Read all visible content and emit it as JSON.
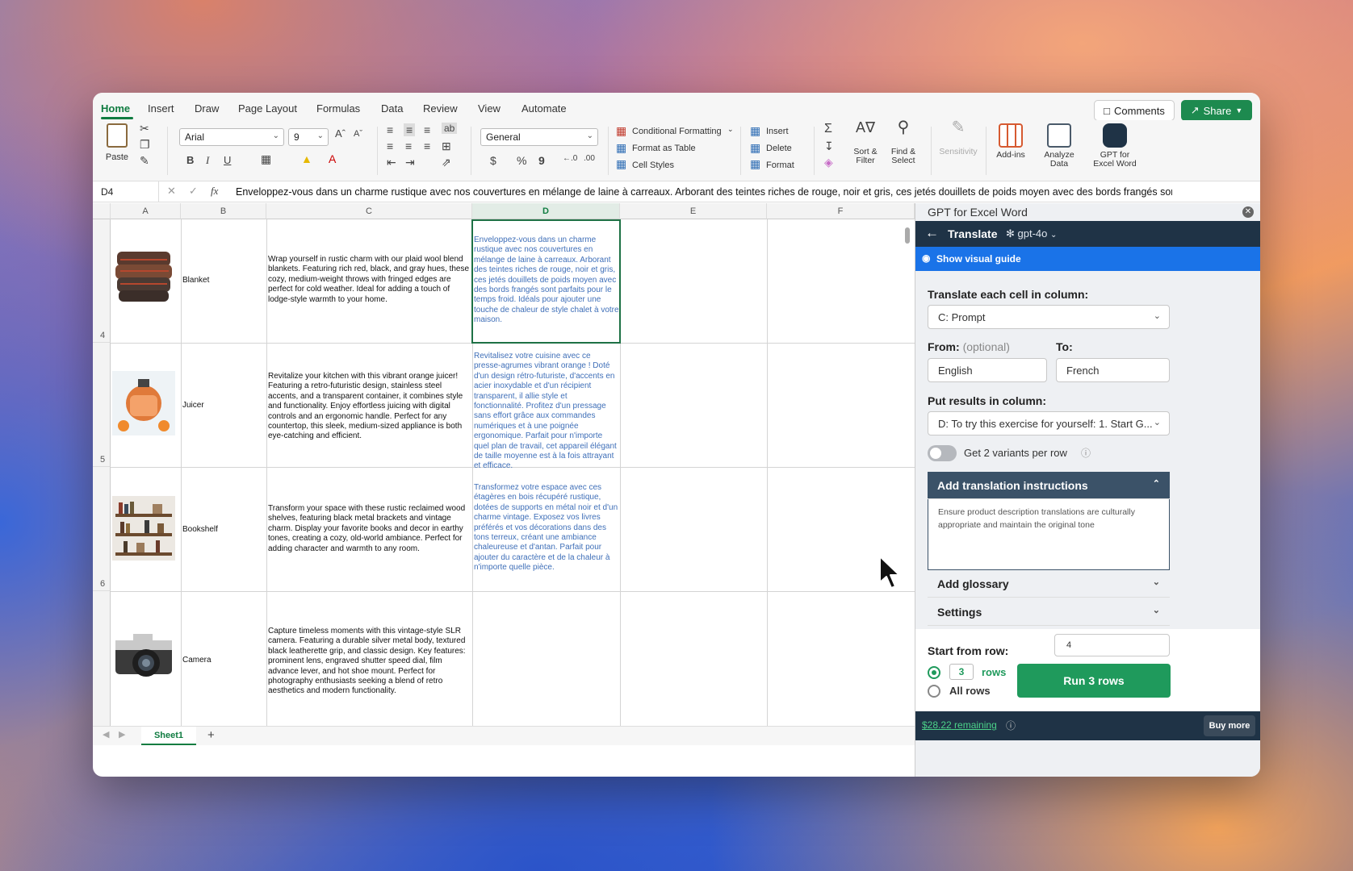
{
  "tabs": [
    "Home",
    "Insert",
    "Draw",
    "Page Layout",
    "Formulas",
    "Data",
    "Review",
    "View",
    "Automate"
  ],
  "active_tab": "Home",
  "topbar": {
    "comments": "Comments",
    "share": "Share"
  },
  "ribbon": {
    "paste": "Paste",
    "font_name": "Arial",
    "font_size": "9",
    "bold": "B",
    "italic": "I",
    "underline": "U",
    "number_format": "General",
    "currency": "$",
    "percent": "%",
    "comma": "9",
    "conditional_formatting": "Conditional Formatting",
    "format_as_table": "Format as Table",
    "cell_styles": "Cell Styles",
    "insert": "Insert",
    "delete": "Delete",
    "format": "Format",
    "sort_filter": "Sort & Filter",
    "find_select": "Find & Select",
    "sensitivity": "Sensitivity",
    "addins": "Add-ins",
    "analyze_data": "Analyze Data",
    "gpt": "GPT for Excel Word"
  },
  "formula_bar": {
    "cell_ref": "D4",
    "fx": "fx",
    "content": "Enveloppez-vous dans un charme rustique avec nos couvertures en mélange de laine à carreaux. Arborant des teintes riches de rouge, noir et gris, ces jetés douillets de poids moyen avec des bords frangés sont parfaits"
  },
  "grid": {
    "columns": [
      "A",
      "B",
      "C",
      "D",
      "E",
      "F"
    ],
    "rows": [
      {
        "num": "4",
        "name": "Blanket",
        "prompt": "Wrap yourself in rustic charm with our plaid wool blend blankets. Featuring rich red, black, and gray hues, these cozy, medium-weight throws with fringed edges are perfect for cold weather. Ideal for adding a touch of lodge-style warmth to your home.",
        "translation": "Enveloppez-vous dans un charme rustique avec nos couvertures en mélange de laine à carreaux. Arborant des teintes riches de rouge, noir et gris, ces jetés douillets de poids moyen avec des bords frangés sont parfaits pour le temps froid. Idéals pour ajouter une touche de chaleur de style chalet à votre maison."
      },
      {
        "num": "5",
        "name": "Juicer",
        "prompt": "Revitalize your kitchen with this vibrant orange juicer! Featuring a retro-futuristic design, stainless steel accents, and a transparent container, it combines style and functionality. Enjoy effortless juicing with digital controls and an ergonomic handle. Perfect for any countertop, this sleek, medium-sized appliance is both eye-catching and efficient.",
        "translation": "Revitalisez votre cuisine avec ce presse-agrumes vibrant orange ! Doté d'un design rétro-futuriste, d'accents en acier inoxydable et d'un récipient transparent, il allie style et fonctionnalité. Profitez d'un pressage sans effort grâce aux commandes numériques et à une poignée ergonomique. Parfait pour n'importe quel plan de travail, cet appareil élégant de taille moyenne est à la fois attrayant et efficace."
      },
      {
        "num": "6",
        "name": "Bookshelf",
        "prompt": "Transform your space with these rustic reclaimed wood shelves, featuring black metal brackets and vintage charm. Display your favorite books and decor in earthy tones, creating a cozy, old-world ambiance. Perfect for adding character and warmth to any room.",
        "translation": "Transformez votre espace avec ces étagères en bois récupéré rustique, dotées de supports en métal noir et d'un charme vintage. Exposez vos livres préférés et vos décorations dans des tons terreux, créant une ambiance chaleureuse et d'antan. Parfait pour ajouter du caractère et de la chaleur à n'importe quelle pièce."
      },
      {
        "num": "",
        "name": "Camera",
        "prompt": "Capture timeless moments with this vintage-style SLR camera. Featuring a durable silver metal body, textured black leatherette grip, and classic design. Key features: prominent lens, engraved shutter speed dial, film advance lever, and hot shoe mount. Perfect for photography enthusiasts seeking a blend of retro aesthetics and modern functionality.",
        "translation": ""
      }
    ]
  },
  "sheet_tab": "Sheet1",
  "panel": {
    "title": "GPT for Excel Word",
    "nav_title": "Translate",
    "model": "gpt-4o",
    "visual_guide": "Show visual guide",
    "translate_label": "Translate each cell in column:",
    "translate_value": "C: Prompt",
    "from_label": "From:",
    "from_optional": "(optional)",
    "from_value": "English",
    "to_label": "To:",
    "to_value": "French",
    "results_label": "Put results in column:",
    "results_value": "D: To try this exercise for yourself: 1. Start G...",
    "variants_label": "Get 2 variants per row",
    "instructions_title": "Add translation instructions",
    "instructions_text": "Ensure product description translations are culturally appropriate and maintain the original tone",
    "glossary_title": "Add glossary",
    "settings_title": "Settings",
    "start_row_label": "Start from row:",
    "start_row_value": "4",
    "rows_count": "3",
    "rows_label": "rows",
    "all_rows_label": "All rows",
    "run_button": "Run 3 rows",
    "remaining_amount": "$28.22",
    "remaining_label": "remaining",
    "buy_more": "Buy more"
  }
}
